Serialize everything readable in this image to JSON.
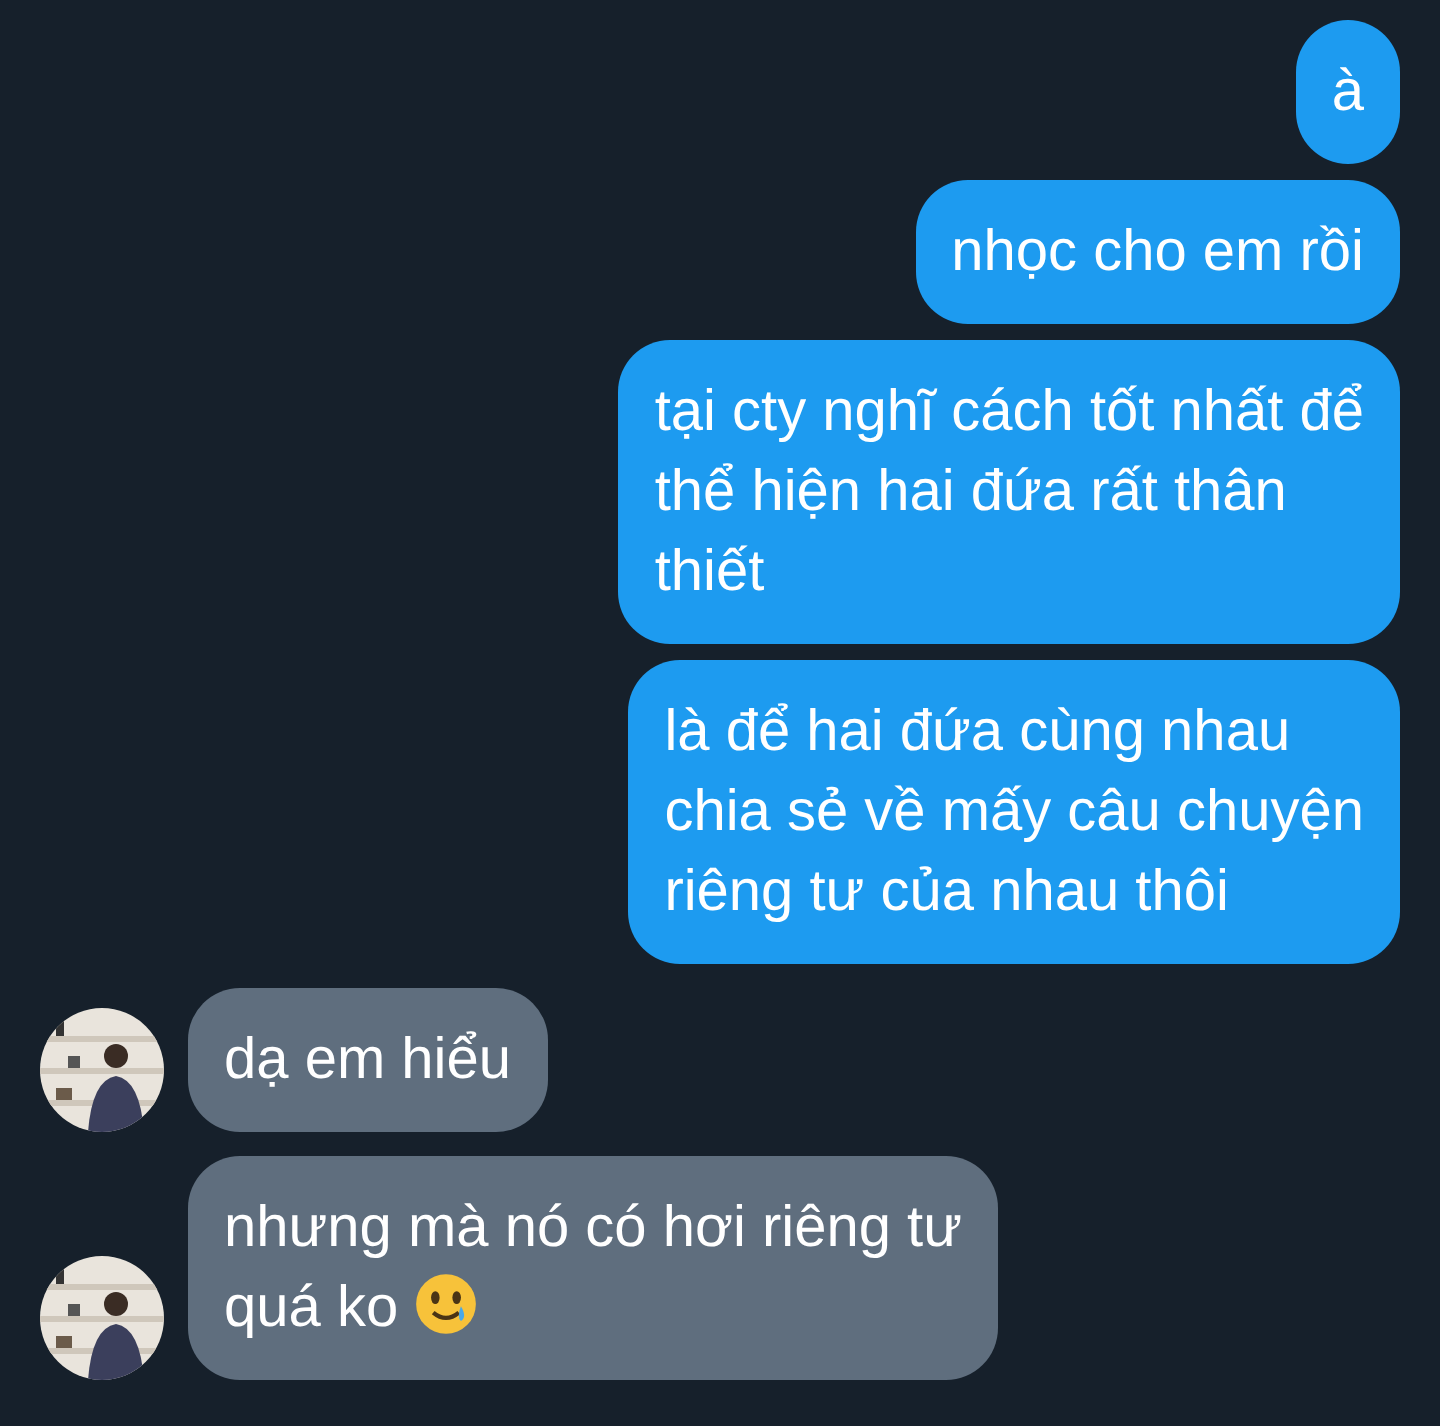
{
  "messages": [
    {
      "kind": "sent",
      "lines": [
        "à"
      ]
    },
    {
      "kind": "sent",
      "lines": [
        "nhọc cho em rồi"
      ]
    },
    {
      "kind": "sent",
      "lines": [
        "tại cty nghĩ cách tốt nhất để",
        "thể hiện hai đứa rất thân",
        "thiết"
      ]
    },
    {
      "kind": "sent",
      "lines": [
        "là để hai đứa cùng nhau",
        "chia sẻ về mấy câu chuyện",
        "riêng tư của nhau thôi"
      ]
    },
    {
      "kind": "received",
      "lines": [
        "dạ em hiểu"
      ]
    },
    {
      "kind": "received",
      "lines": [
        "nhưng mà nó có hơi riêng tư",
        "quá ko"
      ],
      "emoji": true
    }
  ]
}
